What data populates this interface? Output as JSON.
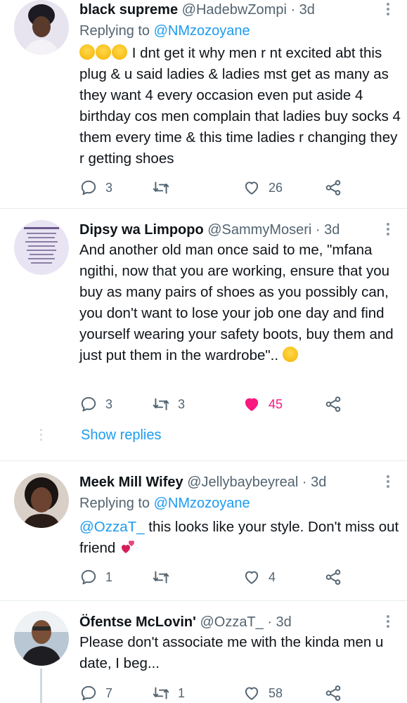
{
  "tweets": [
    {
      "name": "black supreme",
      "handle": "@HadebwZompi",
      "time": "· 3d",
      "replying_label": "Replying to ",
      "replying_handle": "@NMzozoyane",
      "text": "I dnt get it why men r nt excited abt this plug & u said ladies & ladies mst get as many as they want 4 every occasion even put aside 4 birthday cos men complain that ladies buy socks 4 them every time & this time ladies r changing they r getting shoes",
      "replies": "3",
      "retweets": "",
      "likes": "26",
      "liked": false
    },
    {
      "name": "Dipsy wa Limpopo",
      "handle": "@SammyMoseri",
      "time": "· 3d",
      "text": "And another old man once said to me, \"mfana ngithi, now that you are working, ensure that you buy as many pairs of shoes as you possibly can, you don't want to lose your job one day and find yourself wearing your safety boots, buy them and just put them in the wardrobe\"..",
      "replies": "3",
      "retweets": "3",
      "likes": "45",
      "liked": true
    },
    {
      "name": "Meek Mill Wifey",
      "handle": "@Jellybaybeyreal",
      "time": "· 3d",
      "replying_label": "Replying to ",
      "replying_handle": "@NMzozoyane",
      "mention": "@OzzaT_",
      "text": " this looks like your style. Don't miss out friend",
      "replies": "1",
      "retweets": "",
      "likes": "4",
      "liked": false
    },
    {
      "name": "Öfentse McLovin'",
      "handle": "@OzzaT_",
      "time": "· 3d",
      "text": "Please don't associate me with the kinda men u date, I beg...",
      "replies": "7",
      "retweets": "1",
      "likes": "58",
      "liked": false
    }
  ],
  "show_replies": "Show replies",
  "colors": {
    "accent": "#1d9bf0",
    "like": "#f91880",
    "text": "#0f1419",
    "muted": "#536471"
  },
  "icons": [
    "reply-icon",
    "retweet-icon",
    "like-icon",
    "share-icon",
    "more-icon"
  ]
}
